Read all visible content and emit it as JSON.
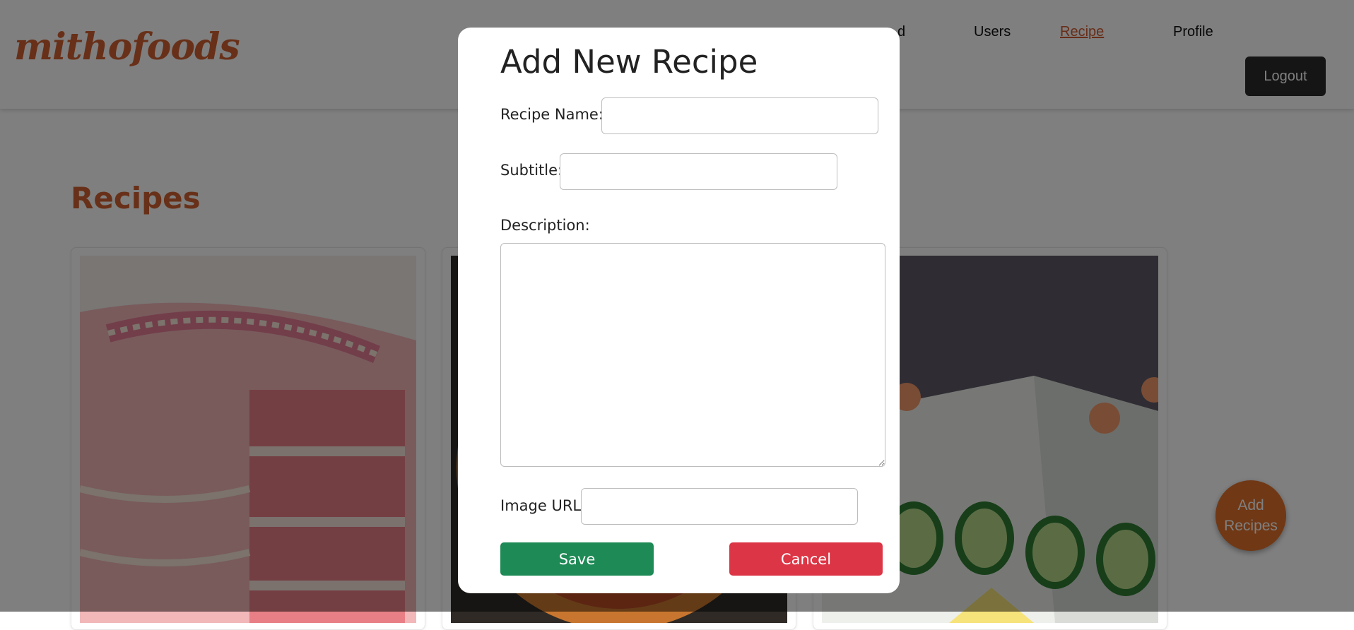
{
  "brand": {
    "logo_text": "mithofoods",
    "color": "#d06030"
  },
  "nav": {
    "items": [
      {
        "label": "d"
      },
      {
        "label": "Users"
      },
      {
        "label": "Recipe",
        "active": true
      },
      {
        "label": "Profile"
      }
    ],
    "active_color": "#d05a30",
    "logout_label": "Logout"
  },
  "main": {
    "title": "Recipes",
    "cards": [
      {
        "image": "pink-layer-cake-photo"
      },
      {
        "image": "pizza-photo"
      },
      {
        "image": "cucumber-salmon-sandwich-cake-photo"
      }
    ]
  },
  "fab": {
    "label_line1": "Add",
    "label_line2": "Recipes",
    "color": "#e0702a"
  },
  "modal": {
    "title": "Add New Recipe",
    "fields": {
      "name": {
        "label": "Recipe Name:",
        "value": "",
        "placeholder": ""
      },
      "subtitle": {
        "label": "Subtitle:",
        "value": "",
        "placeholder": ""
      },
      "description": {
        "label": "Description:",
        "value": "",
        "placeholder": ""
      },
      "image_url": {
        "label": "Image URL:",
        "value": "",
        "placeholder": ""
      }
    },
    "save_label": "Save",
    "cancel_label": "Cancel",
    "save_color": "#1e8a55",
    "cancel_color": "#dc3545"
  }
}
